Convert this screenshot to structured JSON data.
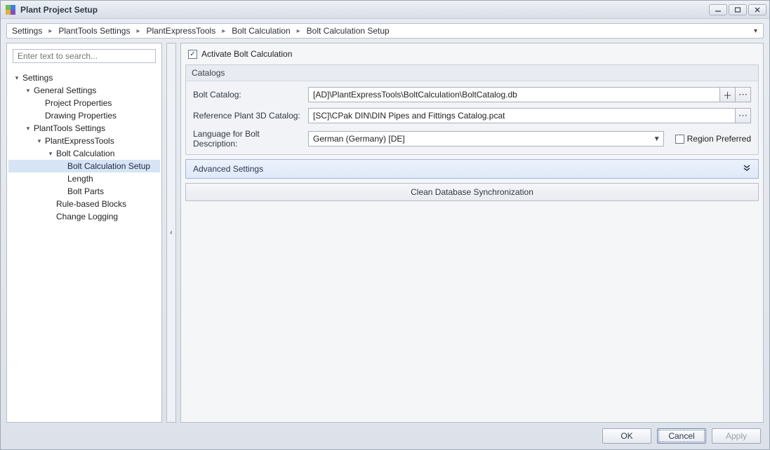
{
  "window": {
    "title": "Plant Project Setup"
  },
  "breadcrumb": {
    "items": [
      "Settings",
      "PlantTools Settings",
      "PlantExpressTools",
      "Bolt Calculation",
      "Bolt Calculation Setup"
    ]
  },
  "sidebar": {
    "search_placeholder": "Enter text to search...",
    "tree": {
      "n0": {
        "label": "Settings"
      },
      "n1": {
        "label": "General Settings"
      },
      "n2": {
        "label": "Project Properties"
      },
      "n3": {
        "label": "Drawing Properties"
      },
      "n4": {
        "label": "PlantTools Settings"
      },
      "n5": {
        "label": "PlantExpressTools"
      },
      "n6": {
        "label": "Bolt Calculation"
      },
      "n7": {
        "label": "Bolt Calculation Setup"
      },
      "n8": {
        "label": "Length"
      },
      "n9": {
        "label": "Bolt Parts"
      },
      "n10": {
        "label": "Rule-based Blocks"
      },
      "n11": {
        "label": "Change Logging"
      }
    }
  },
  "main": {
    "activate_label": "Activate Bolt Calculation",
    "catalogs": {
      "title": "Catalogs",
      "bolt_catalog_label": "Bolt Catalog:",
      "bolt_catalog_value": "[AD]\\PlantExpressTools\\BoltCalculation\\BoltCatalog.db",
      "ref_catalog_label": "Reference Plant 3D Catalog:",
      "ref_catalog_value": "[SC]\\CPak DIN\\DIN Pipes and Fittings Catalog.pcat",
      "lang_label": "Language for Bolt Description:",
      "lang_value": "German (Germany) [DE]",
      "region_pref_label": "Region Preferred"
    },
    "advanced_label": "Advanced Settings",
    "clean_label": "Clean Database Synchronization"
  },
  "footer": {
    "ok": "OK",
    "cancel": "Cancel",
    "apply": "Apply"
  }
}
